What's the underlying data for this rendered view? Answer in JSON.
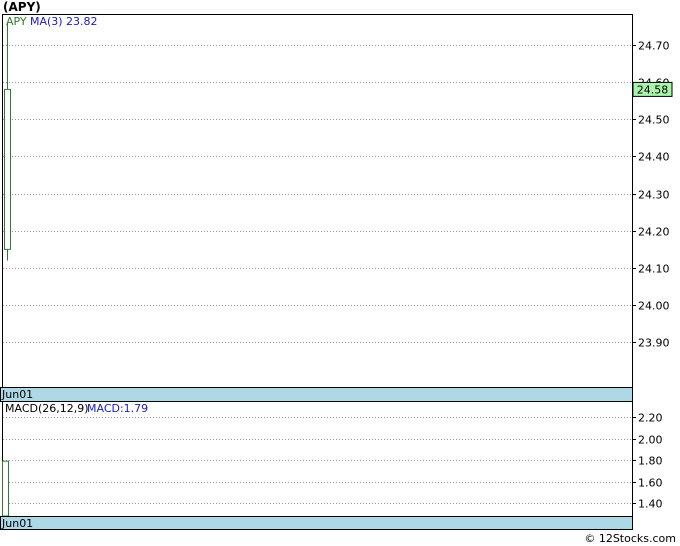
{
  "title": "(APY)",
  "footer": "© 12Stocks.com",
  "colors": {
    "candle": "#2e7d32",
    "ma": "#1a1ac0",
    "grid": "#999999",
    "date_band": "#add8e6",
    "last_price_bg": "#a9f5a9",
    "border": "#000000"
  },
  "chart_data": [
    {
      "type": "candlestick",
      "legend": {
        "symbol": "APY",
        "ma_label": "MA(3)",
        "ma_value": "23.82"
      },
      "x_tick_labels": [
        "Jun01"
      ],
      "y_tick_labels": [
        "24.70",
        "24.60",
        "24.50",
        "24.40",
        "24.30",
        "24.20",
        "24.10",
        "24.00",
        "23.90"
      ],
      "ylim": [
        23.78,
        24.78
      ],
      "last_price": 24.58,
      "last_price_label": "24.58",
      "candles": [
        {
          "date": "Jun01",
          "open": 24.15,
          "close": 24.58,
          "high": 24.76,
          "low": 24.12
        }
      ],
      "grid": true
    },
    {
      "type": "macd",
      "legend": {
        "label": "MACD(26,12,9)",
        "value_label": "MACD:1.79"
      },
      "x_tick_labels": [
        "Jun01"
      ],
      "y_tick_labels": [
        "2.20",
        "2.00",
        "1.80",
        "1.60",
        "1.40"
      ],
      "ylim": [
        1.28,
        2.34
      ],
      "bars": [
        {
          "date": "Jun01",
          "value": 1.79
        }
      ],
      "grid": true
    }
  ]
}
